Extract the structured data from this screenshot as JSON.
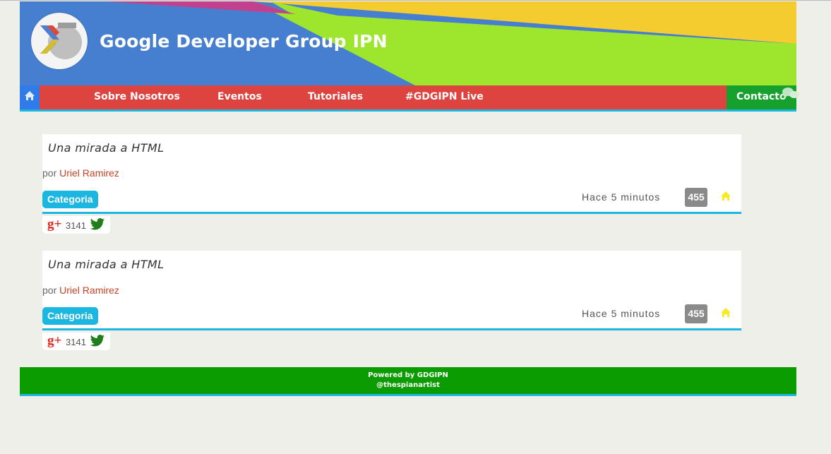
{
  "header": {
    "title": "Google Developer Group IPN",
    "colors": {
      "blue": "#477fd0",
      "yellow": "#f5cc30",
      "green": "#9ee62e",
      "pink": "#c2418f"
    }
  },
  "nav": {
    "home_icon": "home-icon",
    "items": [
      {
        "label": "Sobre Nosotros"
      },
      {
        "label": "Eventos"
      },
      {
        "label": "Tutoriales"
      },
      {
        "label": "#GDGIPN Live"
      }
    ],
    "contact": {
      "label": "Contacto",
      "icon": "chat-bubbles-icon"
    },
    "colors": {
      "red": "#dd4440",
      "home": "#2f7bea",
      "contact": "#16a12f",
      "underline": "#1cb7e0"
    }
  },
  "posts": [
    {
      "title": "Una mirada a HTML",
      "by_prefix": "por",
      "author": "Uriel Ramirez",
      "category": "Categoria",
      "time": "Hace 5 minutos",
      "count": "455",
      "shares": {
        "gplus_label": "g+",
        "count": "3141"
      }
    },
    {
      "title": "Una mirada a HTML",
      "by_prefix": "por",
      "author": "Uriel Ramirez",
      "category": "Categoria",
      "time": "Hace 5 minutos",
      "count": "455",
      "shares": {
        "gplus_label": "g+",
        "count": "3141"
      }
    }
  ],
  "footer": {
    "line1": "Powered by GDGIPN",
    "line2": "@thespianartist",
    "color": "#0a9c00"
  }
}
